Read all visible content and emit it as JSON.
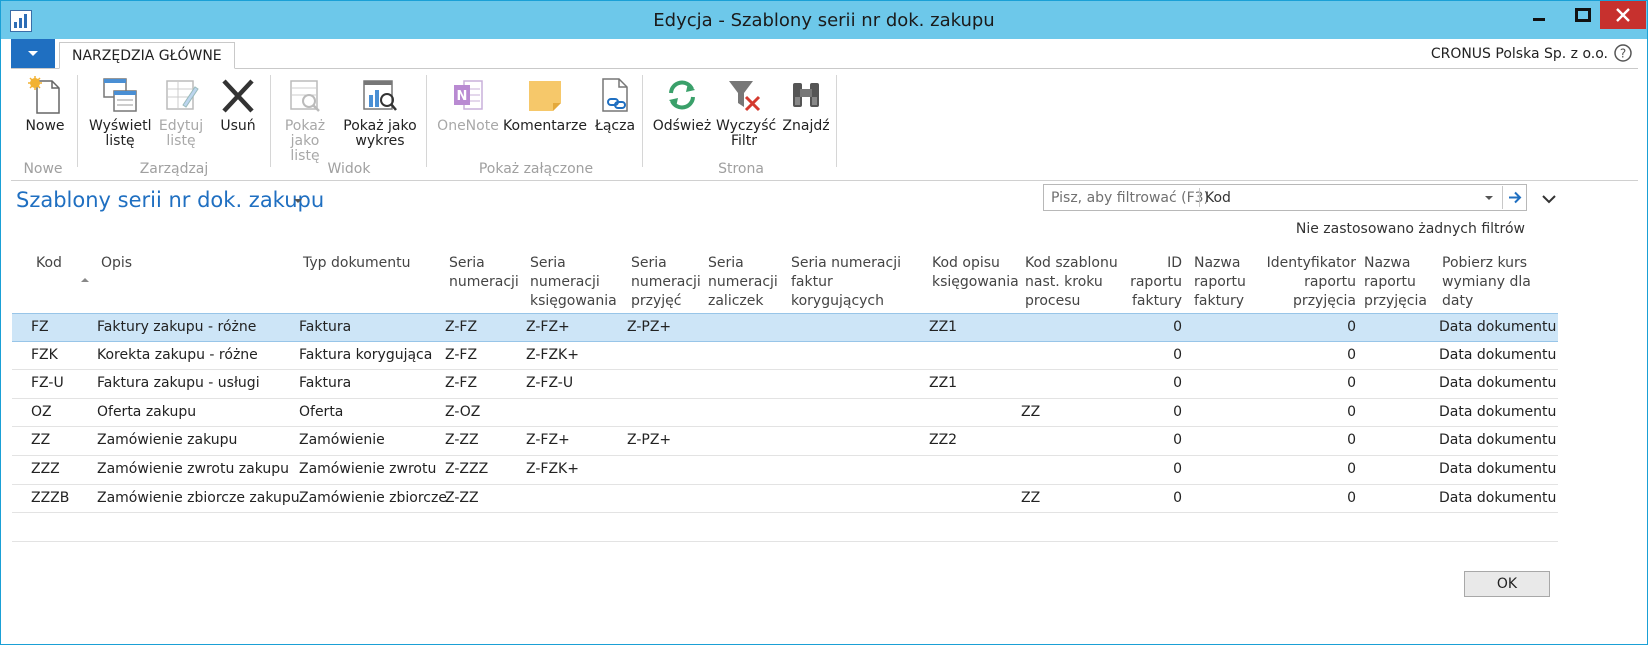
{
  "window": {
    "title": "Edycja - Szablony serii nr dok. zakupu"
  },
  "ribbon": {
    "tab_home": "NARZĘDZIA GŁÓWNE",
    "company": "CRONUS Polska Sp. z o.o.",
    "groups": [
      {
        "label": "Nowe",
        "buttons": [
          {
            "label": "Nowe",
            "icon": "new-document-icon",
            "enabled": true
          }
        ]
      },
      {
        "label": "Zarządzaj",
        "buttons": [
          {
            "label": "Wyświetl listę",
            "icon": "view-list-icon",
            "enabled": true
          },
          {
            "label": "Edytuj listę",
            "icon": "edit-list-icon",
            "enabled": false
          },
          {
            "label": "Usuń",
            "icon": "delete-x-icon",
            "enabled": true
          }
        ]
      },
      {
        "label": "Widok",
        "buttons": [
          {
            "label": "Pokaż jako listę",
            "icon": "show-as-list-icon",
            "enabled": false
          },
          {
            "label": "Pokaż jako wykres",
            "icon": "show-as-chart-icon",
            "enabled": true
          }
        ]
      },
      {
        "label": "Pokaż załączone",
        "buttons": [
          {
            "label": "OneNote",
            "icon": "onenote-icon",
            "enabled": false
          },
          {
            "label": "Komentarze",
            "icon": "comment-note-icon",
            "enabled": true
          },
          {
            "label": "Łącza",
            "icon": "links-icon",
            "enabled": true
          }
        ]
      },
      {
        "label": "Strona",
        "buttons": [
          {
            "label": "Odśwież",
            "icon": "refresh-icon",
            "enabled": true
          },
          {
            "label": "Wyczyść Filtr",
            "icon": "clear-filter-icon",
            "enabled": true
          },
          {
            "label": "Znajdź",
            "icon": "binoculars-icon",
            "enabled": true
          }
        ]
      }
    ]
  },
  "page": {
    "title": "Szablony serii nr dok. zakupu",
    "filter_placeholder": "Pisz, aby filtrować (F3)",
    "filter_field": "Kod",
    "no_filters": "Nie zastosowano żadnych filtrów"
  },
  "columns": [
    "Kod",
    "Opis",
    "Typ dokumentu",
    "Seria numeracji",
    "Seria numeracji księgowania",
    "Seria numeracji przyjęć",
    "Seria numeracji zaliczek",
    "Seria numeracji faktur korygujących zaliczki",
    "Kod opisu księgowania",
    "Kod szablonu nast. kroku procesu",
    "ID raportu faktury",
    "Nazwa raportu faktury",
    "Identyfikator raportu przyjęcia",
    "Nazwa raportu przyjęcia",
    "Pobierz kurs wymiany dla daty"
  ],
  "rows": [
    [
      "FZ",
      "Faktury zakupu - różne",
      "Faktura",
      "Z-FZ",
      "Z-FZ+",
      "Z-PZ+",
      "",
      "",
      "ZZ1",
      "",
      "0",
      "",
      "0",
      "",
      "Data dokumentu"
    ],
    [
      "FZK",
      "Korekta zakupu - różne",
      "Faktura korygująca",
      "Z-FZ",
      "Z-FZK+",
      "",
      "",
      "",
      "",
      "",
      "0",
      "",
      "0",
      "",
      "Data dokumentu"
    ],
    [
      "FZ-U",
      "Faktura zakupu - usługi",
      "Faktura",
      "Z-FZ",
      "Z-FZ-U",
      "",
      "",
      "",
      "ZZ1",
      "",
      "0",
      "",
      "0",
      "",
      "Data dokumentu"
    ],
    [
      "OZ",
      "Oferta zakupu",
      "Oferta",
      "Z-OZ",
      "",
      "",
      "",
      "",
      "",
      "ZZ",
      "0",
      "",
      "0",
      "",
      "Data dokumentu"
    ],
    [
      "ZZ",
      "Zamówienie zakupu",
      "Zamówienie",
      "Z-ZZ",
      "Z-FZ+",
      "Z-PZ+",
      "",
      "",
      "ZZ2",
      "",
      "0",
      "",
      "0",
      "",
      "Data dokumentu"
    ],
    [
      "ZZZ",
      "Zamówienie zwrotu zakupu",
      "Zamówienie zwrotu",
      "Z-ZZZ",
      "Z-FZK+",
      "",
      "",
      "",
      "",
      "",
      "0",
      "",
      "0",
      "",
      "Data dokumentu"
    ],
    [
      "ZZZB",
      "Zamówienie zbiorcze zakupu",
      "Zamówienie zbiorcze",
      "Z-ZZ",
      "",
      "",
      "",
      "",
      "",
      "ZZ",
      "0",
      "",
      "0",
      "",
      "Data dokumentu"
    ]
  ],
  "selected_row": 0,
  "ok_label": "OK",
  "colors": {
    "accent": "#1f6fc1",
    "titlebar": "#6dc8ea",
    "selection": "#cde5f7",
    "close": "#c7312e"
  }
}
